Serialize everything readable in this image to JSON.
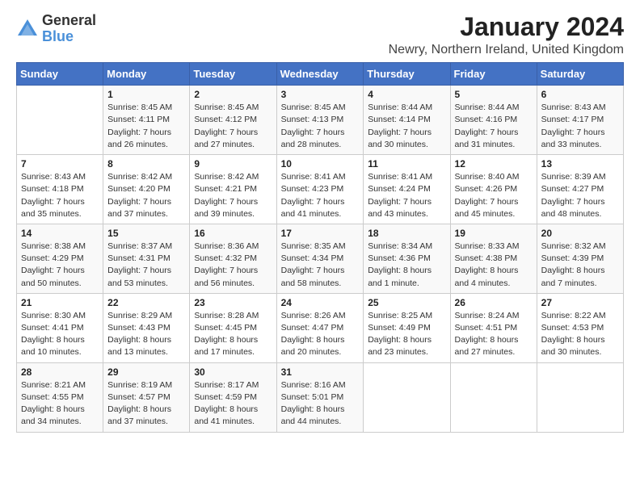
{
  "header": {
    "logo_general": "General",
    "logo_blue": "Blue",
    "main_title": "January 2024",
    "subtitle": "Newry, Northern Ireland, United Kingdom"
  },
  "calendar": {
    "days_of_week": [
      "Sunday",
      "Monday",
      "Tuesday",
      "Wednesday",
      "Thursday",
      "Friday",
      "Saturday"
    ],
    "weeks": [
      [
        {
          "day": "",
          "sunrise": "",
          "sunset": "",
          "daylight": ""
        },
        {
          "day": "1",
          "sunrise": "Sunrise: 8:45 AM",
          "sunset": "Sunset: 4:11 PM",
          "daylight": "Daylight: 7 hours and 26 minutes."
        },
        {
          "day": "2",
          "sunrise": "Sunrise: 8:45 AM",
          "sunset": "Sunset: 4:12 PM",
          "daylight": "Daylight: 7 hours and 27 minutes."
        },
        {
          "day": "3",
          "sunrise": "Sunrise: 8:45 AM",
          "sunset": "Sunset: 4:13 PM",
          "daylight": "Daylight: 7 hours and 28 minutes."
        },
        {
          "day": "4",
          "sunrise": "Sunrise: 8:44 AM",
          "sunset": "Sunset: 4:14 PM",
          "daylight": "Daylight: 7 hours and 30 minutes."
        },
        {
          "day": "5",
          "sunrise": "Sunrise: 8:44 AM",
          "sunset": "Sunset: 4:16 PM",
          "daylight": "Daylight: 7 hours and 31 minutes."
        },
        {
          "day": "6",
          "sunrise": "Sunrise: 8:43 AM",
          "sunset": "Sunset: 4:17 PM",
          "daylight": "Daylight: 7 hours and 33 minutes."
        }
      ],
      [
        {
          "day": "7",
          "sunrise": "Sunrise: 8:43 AM",
          "sunset": "Sunset: 4:18 PM",
          "daylight": "Daylight: 7 hours and 35 minutes."
        },
        {
          "day": "8",
          "sunrise": "Sunrise: 8:42 AM",
          "sunset": "Sunset: 4:20 PM",
          "daylight": "Daylight: 7 hours and 37 minutes."
        },
        {
          "day": "9",
          "sunrise": "Sunrise: 8:42 AM",
          "sunset": "Sunset: 4:21 PM",
          "daylight": "Daylight: 7 hours and 39 minutes."
        },
        {
          "day": "10",
          "sunrise": "Sunrise: 8:41 AM",
          "sunset": "Sunset: 4:23 PM",
          "daylight": "Daylight: 7 hours and 41 minutes."
        },
        {
          "day": "11",
          "sunrise": "Sunrise: 8:41 AM",
          "sunset": "Sunset: 4:24 PM",
          "daylight": "Daylight: 7 hours and 43 minutes."
        },
        {
          "day": "12",
          "sunrise": "Sunrise: 8:40 AM",
          "sunset": "Sunset: 4:26 PM",
          "daylight": "Daylight: 7 hours and 45 minutes."
        },
        {
          "day": "13",
          "sunrise": "Sunrise: 8:39 AM",
          "sunset": "Sunset: 4:27 PM",
          "daylight": "Daylight: 7 hours and 48 minutes."
        }
      ],
      [
        {
          "day": "14",
          "sunrise": "Sunrise: 8:38 AM",
          "sunset": "Sunset: 4:29 PM",
          "daylight": "Daylight: 7 hours and 50 minutes."
        },
        {
          "day": "15",
          "sunrise": "Sunrise: 8:37 AM",
          "sunset": "Sunset: 4:31 PM",
          "daylight": "Daylight: 7 hours and 53 minutes."
        },
        {
          "day": "16",
          "sunrise": "Sunrise: 8:36 AM",
          "sunset": "Sunset: 4:32 PM",
          "daylight": "Daylight: 7 hours and 56 minutes."
        },
        {
          "day": "17",
          "sunrise": "Sunrise: 8:35 AM",
          "sunset": "Sunset: 4:34 PM",
          "daylight": "Daylight: 7 hours and 58 minutes."
        },
        {
          "day": "18",
          "sunrise": "Sunrise: 8:34 AM",
          "sunset": "Sunset: 4:36 PM",
          "daylight": "Daylight: 8 hours and 1 minute."
        },
        {
          "day": "19",
          "sunrise": "Sunrise: 8:33 AM",
          "sunset": "Sunset: 4:38 PM",
          "daylight": "Daylight: 8 hours and 4 minutes."
        },
        {
          "day": "20",
          "sunrise": "Sunrise: 8:32 AM",
          "sunset": "Sunset: 4:39 PM",
          "daylight": "Daylight: 8 hours and 7 minutes."
        }
      ],
      [
        {
          "day": "21",
          "sunrise": "Sunrise: 8:30 AM",
          "sunset": "Sunset: 4:41 PM",
          "daylight": "Daylight: 8 hours and 10 minutes."
        },
        {
          "day": "22",
          "sunrise": "Sunrise: 8:29 AM",
          "sunset": "Sunset: 4:43 PM",
          "daylight": "Daylight: 8 hours and 13 minutes."
        },
        {
          "day": "23",
          "sunrise": "Sunrise: 8:28 AM",
          "sunset": "Sunset: 4:45 PM",
          "daylight": "Daylight: 8 hours and 17 minutes."
        },
        {
          "day": "24",
          "sunrise": "Sunrise: 8:26 AM",
          "sunset": "Sunset: 4:47 PM",
          "daylight": "Daylight: 8 hours and 20 minutes."
        },
        {
          "day": "25",
          "sunrise": "Sunrise: 8:25 AM",
          "sunset": "Sunset: 4:49 PM",
          "daylight": "Daylight: 8 hours and 23 minutes."
        },
        {
          "day": "26",
          "sunrise": "Sunrise: 8:24 AM",
          "sunset": "Sunset: 4:51 PM",
          "daylight": "Daylight: 8 hours and 27 minutes."
        },
        {
          "day": "27",
          "sunrise": "Sunrise: 8:22 AM",
          "sunset": "Sunset: 4:53 PM",
          "daylight": "Daylight: 8 hours and 30 minutes."
        }
      ],
      [
        {
          "day": "28",
          "sunrise": "Sunrise: 8:21 AM",
          "sunset": "Sunset: 4:55 PM",
          "daylight": "Daylight: 8 hours and 34 minutes."
        },
        {
          "day": "29",
          "sunrise": "Sunrise: 8:19 AM",
          "sunset": "Sunset: 4:57 PM",
          "daylight": "Daylight: 8 hours and 37 minutes."
        },
        {
          "day": "30",
          "sunrise": "Sunrise: 8:17 AM",
          "sunset": "Sunset: 4:59 PM",
          "daylight": "Daylight: 8 hours and 41 minutes."
        },
        {
          "day": "31",
          "sunrise": "Sunrise: 8:16 AM",
          "sunset": "Sunset: 5:01 PM",
          "daylight": "Daylight: 8 hours and 44 minutes."
        },
        {
          "day": "",
          "sunrise": "",
          "sunset": "",
          "daylight": ""
        },
        {
          "day": "",
          "sunrise": "",
          "sunset": "",
          "daylight": ""
        },
        {
          "day": "",
          "sunrise": "",
          "sunset": "",
          "daylight": ""
        }
      ]
    ]
  }
}
